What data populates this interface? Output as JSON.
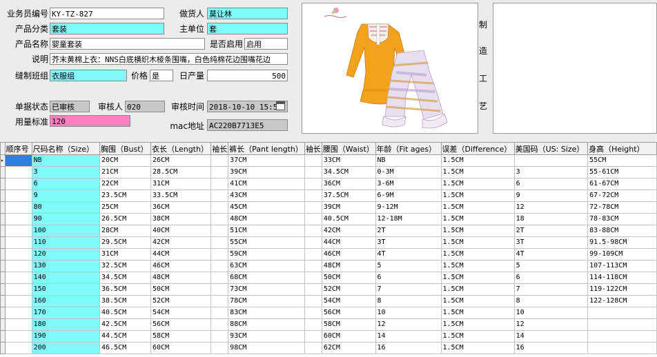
{
  "form": {
    "salesman": {
      "label": "业务员编号",
      "value": "KY-TZ-827"
    },
    "buyer": {
      "label": "做货人",
      "value": "莫让林"
    },
    "category": {
      "label": "产品分类",
      "value": "套装"
    },
    "unit": {
      "label": "主单位",
      "value": "套"
    },
    "product_name": {
      "label": "产品名称",
      "value": "婴童套装"
    },
    "enabled": {
      "label": "是否启用",
      "value": "启用"
    },
    "description": {
      "label": "说明",
      "value": "芥末黄棉上衣：NNS白底横织木棱条围嘴，白色纯棉花边围嘴花边"
    },
    "sewing_group": {
      "label": "缝制班组",
      "value": "衣服组"
    },
    "price": {
      "label": "价格",
      "value": "是"
    },
    "daily_output": {
      "label": "日产量",
      "value": "500"
    },
    "doc_status": {
      "label": "单据状态",
      "value": "已审核"
    },
    "auditor": {
      "label": "审核人",
      "value": "020"
    },
    "audit_time": {
      "label": "审核时间",
      "value": "2018-10-10  15:5"
    },
    "usage_standard": {
      "label": "用量标准",
      "value": "120"
    },
    "mac": {
      "label": "mac地址",
      "value": "AC220B7713E5"
    },
    "process_label": [
      "制",
      "造",
      "工",
      "艺"
    ]
  },
  "colors": {
    "cyan": "#7ffbfb",
    "pink": "#ff7fbf",
    "gray": "#c8c8c8",
    "selection": "#2f7fe0"
  },
  "table": {
    "columns": [
      "顺序号",
      "尺码名称（Size）",
      "胸围（Bust）",
      "衣长（Length）",
      "袖长",
      "裤长（Pant length）",
      "袖长",
      "腰围（Waist）",
      "年龄（Fit ages）",
      "误差（Difference）",
      "美国码（US: Size）",
      "身高（Height）"
    ],
    "rows": [
      [
        "",
        "NB",
        "20CM",
        "26CM",
        "",
        "37CM",
        "",
        "33CM",
        "NB",
        "1.5CM",
        "",
        "55CM"
      ],
      [
        "",
        "3",
        "21CM",
        "28.5CM",
        "",
        "39CM",
        "",
        "34.5CM",
        "0-3M",
        "1.5CM",
        "3",
        "55-61CM"
      ],
      [
        "",
        "6",
        "22CM",
        "31CM",
        "",
        "41CM",
        "",
        "36CM",
        "3-6M",
        "1.5CM",
        "6",
        "61-67CM"
      ],
      [
        "",
        "9",
        "23.5CM",
        "33.5CM",
        "",
        "43CM",
        "",
        "37.5CM",
        "6-9M",
        "1.5CM",
        "9",
        "67-72CM"
      ],
      [
        "",
        "80",
        "25CM",
        "36CM",
        "",
        "45CM",
        "",
        "39CM",
        "9-12M",
        "1.5CM",
        "12",
        "72-78CM"
      ],
      [
        "",
        "90",
        "26.5CM",
        "38CM",
        "",
        "48CM",
        "",
        "40.5CM",
        "12-18M",
        "1.5CM",
        "18",
        "78-83CM"
      ],
      [
        "",
        "100",
        "28CM",
        "40CM",
        "",
        "51CM",
        "",
        "42CM",
        "2T",
        "1.5CM",
        "2T",
        "83-88CM"
      ],
      [
        "",
        "110",
        "29.5CM",
        "42CM",
        "",
        "55CM",
        "",
        "44CM",
        "3T",
        "1.5CM",
        "3T",
        "91.5-98CM"
      ],
      [
        "",
        "120",
        "31CM",
        "44CM",
        "",
        "59CM",
        "",
        "46CM",
        "4T",
        "1.5CM",
        "4T",
        "99-109CM"
      ],
      [
        "",
        "130",
        "32.5CM",
        "46CM",
        "",
        "63CM",
        "",
        "48CM",
        "5",
        "1.5CM",
        "5",
        "107-113CM"
      ],
      [
        "",
        "140",
        "34.5CM",
        "48CM",
        "",
        "68CM",
        "",
        "50CM",
        "6",
        "1.5CM",
        "6",
        "114-118CM"
      ],
      [
        "",
        "150",
        "36.5CM",
        "50CM",
        "",
        "73CM",
        "",
        "52CM",
        "7",
        "1.5CM",
        "7",
        "119-122CM"
      ],
      [
        "",
        "160",
        "38.5CM",
        "52CM",
        "",
        "78CM",
        "",
        "54CM",
        "8",
        "1.5CM",
        "8",
        "122-128CM"
      ],
      [
        "",
        "170",
        "40.5CM",
        "54CM",
        "",
        "83CM",
        "",
        "56CM",
        "10",
        "1.5CM",
        "10",
        ""
      ],
      [
        "",
        "180",
        "42.5CM",
        "56CM",
        "",
        "88CM",
        "",
        "58CM",
        "12",
        "1.5CM",
        "12",
        ""
      ],
      [
        "",
        "190",
        "44.5CM",
        "58CM",
        "",
        "93CM",
        "",
        "60CM",
        "14",
        "1.5CM",
        "14",
        ""
      ],
      [
        "",
        "200",
        "46.5CM",
        "60CM",
        "",
        "98CM",
        "",
        "62CM",
        "16",
        "1.5CM",
        "16",
        ""
      ]
    ]
  }
}
